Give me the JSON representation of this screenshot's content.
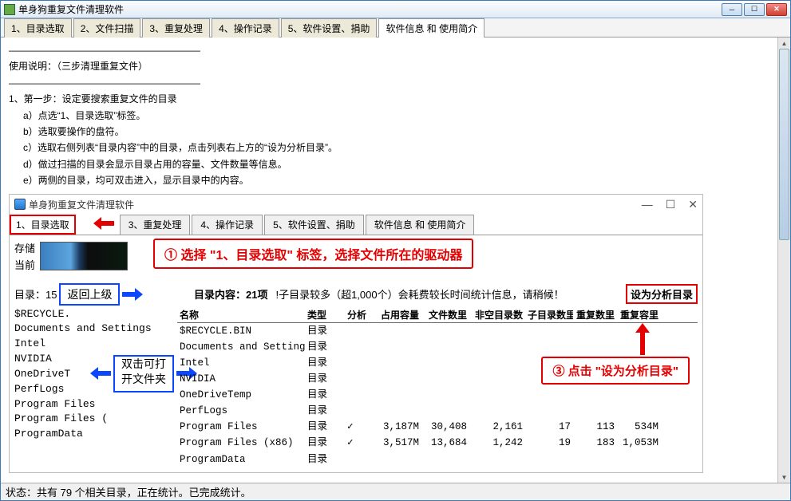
{
  "window": {
    "title": "单身狗重复文件清理软件"
  },
  "tabs": {
    "t1": "1、目录选取",
    "t2": "2、文件扫描",
    "t3": "3、重复处理",
    "t4": "4、操作记录",
    "t5": "5、软件设置、捐助",
    "t6": "软件信息 和 使用简介"
  },
  "help": {
    "dashes": "————————————————————",
    "intro": "    使用说明：（三步清理重复文件）",
    "step1": "1、第一步：设定要搜索重复文件的目录",
    "a": "a）点选“1、目录选取”标签。",
    "b": "b）选取要操作的盘符。",
    "c": "c）选取右侧列表“目录内容”中的目录，点击列表右上方的“设为分析目录”。",
    "d": "d）做过扫描的目录会显示目录占用的容量、文件数量等信息。",
    "e": "e）两侧的目录，均可双击进入，显示目录中的内容。"
  },
  "inner": {
    "title": "单身狗重复文件清理软件",
    "tabs": {
      "t1": "1、目录选取",
      "t3": "3、重复处理",
      "t4": "4、操作记录",
      "t5": "5、软件设置、捐助",
      "t6": "软件信息 和 使用简介"
    },
    "callout1": "① 选择 \"1、目录选取\" 标签，选择文件所在的驱动器",
    "storage_label": "存储",
    "current_label": "当前",
    "dir_label": "目录：15",
    "back_up": "返回上级",
    "dir_content_label": "目录内容：21项",
    "dir_content_warn": "!子目录较多（超1,000个）会耗费较长时间统计信息，请稍候！",
    "set_analysis_btn": "设为分析目录",
    "double_click": "双击可打\n开文件夹",
    "callout3": "③ 点击 \"设为分析目录\"",
    "headers": {
      "name": "名称",
      "type": "类型",
      "an": "分析",
      "size": "占用容量",
      "files": "文件数里",
      "nedir": "非空目录数",
      "subdir": "子目录数里",
      "dupn": "重复数里",
      "dups": "重复容里"
    },
    "left_list": [
      "$RECYCLE.",
      "Documents and Settings",
      "Intel",
      "NVIDIA",
      "OneDriveT",
      "PerfLogs",
      "Program Files",
      "Program Files (",
      "ProgramData"
    ],
    "rows": [
      {
        "name": "$RECYCLE.BIN",
        "type": "目录",
        "an": "",
        "size": "",
        "files": "",
        "nedir": "",
        "subdir": "",
        "dupn": "",
        "dups": ""
      },
      {
        "name": "Documents and Settings",
        "type": "目录",
        "an": "",
        "size": "",
        "files": "",
        "nedir": "",
        "subdir": "",
        "dupn": "",
        "dups": ""
      },
      {
        "name": "Intel",
        "type": "目录",
        "an": "",
        "size": "",
        "files": "",
        "nedir": "",
        "subdir": "",
        "dupn": "",
        "dups": ""
      },
      {
        "name": "NVIDIA",
        "type": "目录",
        "an": "",
        "size": "",
        "files": "",
        "nedir": "",
        "subdir": "",
        "dupn": "",
        "dups": ""
      },
      {
        "name": "OneDriveTemp",
        "type": "目录",
        "an": "",
        "size": "",
        "files": "",
        "nedir": "",
        "subdir": "",
        "dupn": "",
        "dups": ""
      },
      {
        "name": "PerfLogs",
        "type": "目录",
        "an": "",
        "size": "",
        "files": "",
        "nedir": "",
        "subdir": "",
        "dupn": "",
        "dups": ""
      },
      {
        "name": "Program Files",
        "type": "目录",
        "an": "✓",
        "size": "3,187M",
        "files": "30,408",
        "nedir": "2,161",
        "subdir": "17",
        "dupn": "113",
        "dups": "534M"
      },
      {
        "name": "Program Files (x86)",
        "type": "目录",
        "an": "✓",
        "size": "3,517M",
        "files": "13,684",
        "nedir": "1,242",
        "subdir": "19",
        "dupn": "183",
        "dups": "1,053M"
      },
      {
        "name": "ProgramData",
        "type": "目录",
        "an": "",
        "size": "",
        "files": "",
        "nedir": "",
        "subdir": "",
        "dupn": "",
        "dups": ""
      }
    ]
  },
  "status": "状态：共有 79 个相关目录，正在统计。已完成统计。"
}
